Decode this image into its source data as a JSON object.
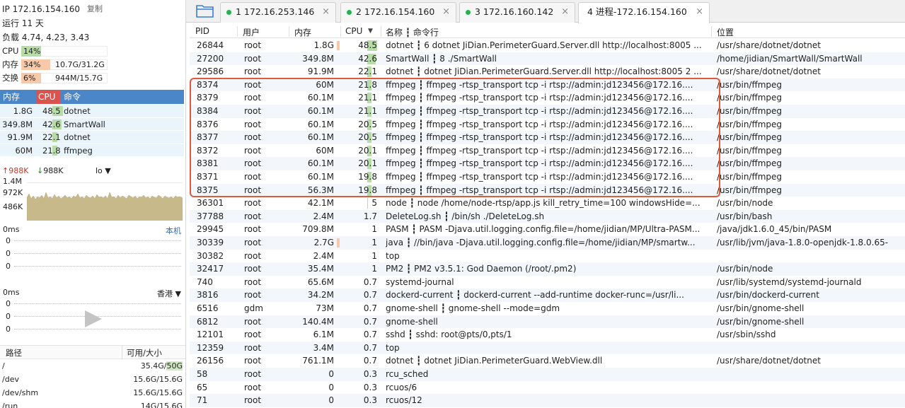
{
  "left": {
    "ip_label": "IP 172.16.154.160",
    "copy_label": "复制",
    "uptime": "运行 11 天",
    "load": "负载 4.74, 4.23, 3.43",
    "cpu": {
      "label": "CPU",
      "pct": "14%",
      "fill": 0.14
    },
    "mem": {
      "label": "内存",
      "pct": "34%",
      "value": "10.7G/31.2G",
      "fill": 0.34
    },
    "swap": {
      "label": "交换",
      "pct": "6%",
      "value": "944M/15.7G",
      "fill": 0.06
    },
    "proc_header": {
      "mem": "内存",
      "cpu": "CPU",
      "cmd": "命令"
    },
    "top_procs": [
      {
        "mem": "1.8G",
        "cpu": "48.5",
        "name": "dotnet"
      },
      {
        "mem": "349.8M",
        "cpu": "42.6",
        "name": "SmartWall"
      },
      {
        "mem": "91.9M",
        "cpu": "22.1",
        "name": "dotnet"
      },
      {
        "mem": "60M",
        "cpu": "21.8",
        "name": "ffmpeg"
      }
    ],
    "net": {
      "up": "988K",
      "down": "988K",
      "iface": "lo",
      "y1": "1.4M",
      "y2": "972K",
      "y3": "486K"
    },
    "latency_local": {
      "title": "0ms",
      "right": "本机",
      "ticks": [
        "0",
        "0",
        "0"
      ]
    },
    "latency_hk": {
      "title": "0ms",
      "right": "香港",
      "ticks": [
        "0",
        "0",
        "0"
      ]
    },
    "disk_header": {
      "path": "路径",
      "size": "可用/大小"
    },
    "disks": [
      {
        "path": "/",
        "avail": "35.4G/",
        "total": "50G"
      },
      {
        "path": "/dev",
        "avail": "15.6G/15.6G",
        "total": ""
      },
      {
        "path": "/dev/shm",
        "avail": "15.6G/15.6G",
        "total": ""
      },
      {
        "path": "/run",
        "avail": "14G/15.6G",
        "total": ""
      }
    ]
  },
  "tabs": [
    {
      "label": "1  172.16.253.146",
      "active": false
    },
    {
      "label": "2  172.16.154.160",
      "active": false
    },
    {
      "label": "3  172.16.160.142",
      "active": false
    },
    {
      "label": "4  进程-172.16.154.160",
      "active": true
    }
  ],
  "table": {
    "headers": {
      "pid": "PID",
      "user": "用户",
      "mem": "内存",
      "cpu": "CPU",
      "cmd": "名称 ┇ 命令行",
      "loc": "位置"
    },
    "rows": [
      {
        "pid": "26844",
        "user": "root",
        "mem": "1.8G",
        "cpu": "48.5",
        "cpu_fill": 0.485,
        "mem_bar": true,
        "cmd": "dotnet ┇ 6 dotnet JiDian.PerimeterGuard.Server.dll http://localhost:8005 ...",
        "loc": "/usr/share/dotnet/dotnet"
      },
      {
        "pid": "27200",
        "user": "root",
        "mem": "349.8M",
        "cpu": "42.6",
        "cpu_fill": 0.426,
        "mem_bar": false,
        "cmd": "SmartWall ┇ 8 ./SmartWall",
        "loc": "/home/jidian/SmartWall/SmartWall"
      },
      {
        "pid": "29586",
        "user": "root",
        "mem": "91.9M",
        "cpu": "22.1",
        "cpu_fill": 0.221,
        "mem_bar": false,
        "cmd": "dotnet ┇ dotnet JiDian.PerimeterGuard.Server.dll http://localhost:8005 2 ...",
        "loc": "/usr/share/dotnet/dotnet"
      },
      {
        "pid": "8374",
        "user": "root",
        "mem": "60M",
        "cpu": "21.8",
        "cpu_fill": 0.218,
        "mem_bar": false,
        "cmd": "ffmpeg ┇ ffmpeg -rtsp_transport tcp -i rtsp://admin:jd123456@172.16....",
        "loc": "/usr/bin/ffmpeg"
      },
      {
        "pid": "8379",
        "user": "root",
        "mem": "60.1M",
        "cpu": "21.1",
        "cpu_fill": 0.211,
        "mem_bar": false,
        "cmd": "ffmpeg ┇ ffmpeg -rtsp_transport tcp -i rtsp://admin:jd123456@172.16....",
        "loc": "/usr/bin/ffmpeg"
      },
      {
        "pid": "8384",
        "user": "root",
        "mem": "60.1M",
        "cpu": "21.1",
        "cpu_fill": 0.211,
        "mem_bar": false,
        "cmd": "ffmpeg ┇ ffmpeg -rtsp_transport tcp -i rtsp://admin:jd123456@172.16....",
        "loc": "/usr/bin/ffmpeg"
      },
      {
        "pid": "8376",
        "user": "root",
        "mem": "60.1M",
        "cpu": "20.5",
        "cpu_fill": 0.205,
        "mem_bar": false,
        "cmd": "ffmpeg ┇ ffmpeg -rtsp_transport tcp -i rtsp://admin:jd123456@172.16....",
        "loc": "/usr/bin/ffmpeg"
      },
      {
        "pid": "8377",
        "user": "root",
        "mem": "60.1M",
        "cpu": "20.5",
        "cpu_fill": 0.205,
        "mem_bar": false,
        "cmd": "ffmpeg ┇ ffmpeg -rtsp_transport tcp -i rtsp://admin:jd123456@172.16....",
        "loc": "/usr/bin/ffmpeg"
      },
      {
        "pid": "8372",
        "user": "root",
        "mem": "60M",
        "cpu": "20.1",
        "cpu_fill": 0.201,
        "mem_bar": false,
        "cmd": "ffmpeg ┇ ffmpeg -rtsp_transport tcp -i rtsp://admin:jd123456@172.16....",
        "loc": "/usr/bin/ffmpeg"
      },
      {
        "pid": "8381",
        "user": "root",
        "mem": "60.1M",
        "cpu": "20.1",
        "cpu_fill": 0.201,
        "mem_bar": false,
        "cmd": "ffmpeg ┇ ffmpeg -rtsp_transport tcp -i rtsp://admin:jd123456@172.16....",
        "loc": "/usr/bin/ffmpeg"
      },
      {
        "pid": "8371",
        "user": "root",
        "mem": "60.1M",
        "cpu": "19.8",
        "cpu_fill": 0.198,
        "mem_bar": false,
        "cmd": "ffmpeg ┇ ffmpeg -rtsp_transport tcp -i rtsp://admin:jd123456@172.16....",
        "loc": "/usr/bin/ffmpeg"
      },
      {
        "pid": "8375",
        "user": "root",
        "mem": "56.3M",
        "cpu": "19.8",
        "cpu_fill": 0.198,
        "mem_bar": false,
        "cmd": "ffmpeg ┇ ffmpeg -rtsp_transport tcp -i rtsp://admin:jd123456@172.16....",
        "loc": "/usr/bin/ffmpeg"
      },
      {
        "pid": "36301",
        "user": "root",
        "mem": "42.1M",
        "cpu": "5",
        "cpu_fill": 0.05,
        "mem_bar": false,
        "cmd": "node ┇ node /home/node-rtsp/app.js kill_retry_time=100 windowsHide=...",
        "loc": "/usr/bin/node"
      },
      {
        "pid": "37788",
        "user": "root",
        "mem": "2.4M",
        "cpu": "1.7",
        "cpu_fill": 0.017,
        "mem_bar": false,
        "cmd": "DeleteLog.sh ┇ /bin/sh ./DeleteLog.sh",
        "loc": "/usr/bin/bash"
      },
      {
        "pid": "29945",
        "user": "root",
        "mem": "709.8M",
        "cpu": "1",
        "cpu_fill": 0.01,
        "mem_bar": false,
        "cmd": "PASM ┇ PASM  -Djava.util.logging.config.file=/home/jidian/MP/Ultra-PASM...",
        "loc": "/java/jdk1.6.0_45/bin/PASM"
      },
      {
        "pid": "30339",
        "user": "root",
        "mem": "2.7G",
        "cpu": "1",
        "cpu_fill": 0.01,
        "mem_bar": true,
        "cmd": "java ┇ //bin/java -Djava.util.logging.config.file=/home/jidian/MP/smartw...",
        "loc": "/usr/lib/jvm/java-1.8.0-openjdk-1.8.0.65-"
      },
      {
        "pid": "30382",
        "user": "root",
        "mem": "2.4M",
        "cpu": "1",
        "cpu_fill": 0.01,
        "mem_bar": false,
        "cmd": "top",
        "loc": ""
      },
      {
        "pid": "32417",
        "user": "root",
        "mem": "35.4M",
        "cpu": "1",
        "cpu_fill": 0.01,
        "mem_bar": false,
        "cmd": "PM2 ┇ PM2 v3.5.1: God Daemon (/root/.pm2)",
        "loc": "/usr/bin/node"
      },
      {
        "pid": "740",
        "user": "root",
        "mem": "65.6M",
        "cpu": "0.7",
        "cpu_fill": 0.007,
        "mem_bar": false,
        "cmd": "systemd-journal",
        "loc": "/usr/lib/systemd/systemd-journald"
      },
      {
        "pid": "3816",
        "user": "root",
        "mem": "34.2M",
        "cpu": "0.7",
        "cpu_fill": 0.007,
        "mem_bar": false,
        "cmd": "dockerd-current ┇ dockerd-current  --add-runtime docker-runc=/usr/li...",
        "loc": "/usr/bin/dockerd-current"
      },
      {
        "pid": "6516",
        "user": "gdm",
        "mem": "73M",
        "cpu": "0.7",
        "cpu_fill": 0.007,
        "mem_bar": false,
        "cmd": "gnome-shell ┇ gnome-shell --mode=gdm",
        "loc": "/usr/bin/gnome-shell"
      },
      {
        "pid": "6812",
        "user": "root",
        "mem": "140.4M",
        "cpu": "0.7",
        "cpu_fill": 0.007,
        "mem_bar": false,
        "cmd": "gnome-shell",
        "loc": "/usr/bin/gnome-shell"
      },
      {
        "pid": "12101",
        "user": "root",
        "mem": "6.1M",
        "cpu": "0.7",
        "cpu_fill": 0.007,
        "mem_bar": false,
        "cmd": "sshd ┇ sshd: root@pts/0,pts/1",
        "loc": "/usr/sbin/sshd"
      },
      {
        "pid": "12359",
        "user": "root",
        "mem": "3.4M",
        "cpu": "0.7",
        "cpu_fill": 0.007,
        "mem_bar": false,
        "cmd": "top",
        "loc": ""
      },
      {
        "pid": "26156",
        "user": "root",
        "mem": "761.1M",
        "cpu": "0.7",
        "cpu_fill": 0.007,
        "mem_bar": false,
        "cmd": "dotnet ┇ dotnet JiDian.PerimeterGuard.WebView.dll",
        "loc": "/usr/share/dotnet/dotnet"
      },
      {
        "pid": "58",
        "user": "root",
        "mem": "0",
        "cpu": "0.3",
        "cpu_fill": 0.003,
        "mem_bar": false,
        "cmd": "rcu_sched",
        "loc": ""
      },
      {
        "pid": "65",
        "user": "root",
        "mem": "0",
        "cpu": "0.3",
        "cpu_fill": 0.003,
        "mem_bar": false,
        "cmd": "rcuos/6",
        "loc": ""
      },
      {
        "pid": "71",
        "user": "root",
        "mem": "0",
        "cpu": "0.3",
        "cpu_fill": 0.003,
        "mem_bar": false,
        "cmd": "rcuos/12",
        "loc": ""
      }
    ]
  },
  "colors": {
    "accent": "#4a86c8",
    "cpu_header": "#d9534f",
    "cpu_bar": "#b8dca8",
    "mem_bar": "#f7c9a8",
    "highlight": "#e0593b",
    "tab_dot": "#27b04f"
  }
}
